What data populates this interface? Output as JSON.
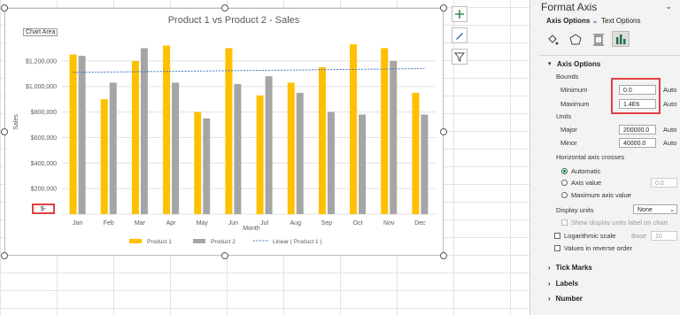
{
  "chart": {
    "title": "Product 1 vs Product 2 - Sales",
    "ylabel": "Sales",
    "xlabel": "Month",
    "chart_area_tooltip": "Chart Area",
    "zero_label": "$-",
    "legend": [
      "Product 1",
      "Product 2",
      "Linear ( Product 1 )"
    ]
  },
  "chart_data": {
    "type": "bar",
    "title": "Product 1 vs Product 2 - Sales",
    "xlabel": "Month",
    "ylabel": "Sales",
    "ylim": [
      0,
      1400000
    ],
    "yticks": [
      "$-",
      "$200,000",
      "$400,000",
      "$600,000",
      "$800,000",
      "$1,000,000",
      "$1,200,000"
    ],
    "categories": [
      "Jan",
      "Feb",
      "Mar",
      "Apr",
      "May",
      "Jun",
      "Jul",
      "Aug",
      "Sep",
      "Oct",
      "Nov",
      "Dec"
    ],
    "series": [
      {
        "name": "Product 1",
        "color": "#FFC000",
        "values": [
          1250000,
          900000,
          1200000,
          1320000,
          800000,
          1300000,
          930000,
          1030000,
          1150000,
          1330000,
          1300000,
          950000
        ]
      },
      {
        "name": "Product 2",
        "color": "#A5A5A5",
        "values": [
          1240000,
          1030000,
          1300000,
          1030000,
          750000,
          1020000,
          1080000,
          950000,
          800000,
          780000,
          1200000,
          780000
        ]
      }
    ],
    "trendline": {
      "name": "Linear ( Product 1 )",
      "color": "#4472C4",
      "start": 1110000,
      "end": 1140000
    },
    "grid": true,
    "legend_position": "bottom"
  },
  "panel": {
    "title": "Format Axis",
    "tabs": [
      "Axis Options",
      "Text Options"
    ],
    "section_axis_options": "Axis Options",
    "bounds_label": "Bounds",
    "minimum_label": "Minimum",
    "minimum_value": "0.0",
    "maximum_label": "Maximum",
    "maximum_value": "1.4E6",
    "auto": "Auto",
    "units_label": "Units",
    "major_label": "Major",
    "major_value": "200000.0",
    "minor_label": "Minor",
    "minor_value": "40000.0",
    "horiz_cross_label": "Horizontal axis crosses",
    "radio_automatic": "Automatic",
    "radio_axis_value": "Axis value",
    "axis_value_input": "0.0",
    "radio_max": "Maximum axis value",
    "display_units_label": "Display units",
    "display_units_value": "None",
    "show_units_label": "Show display units label on chart",
    "log_scale_label": "Logarithmic scale",
    "base_label": "Base",
    "base_value": "10",
    "reverse_label": "Values in reverse order",
    "tick_marks": "Tick Marks",
    "labels": "Labels",
    "number": "Number"
  }
}
